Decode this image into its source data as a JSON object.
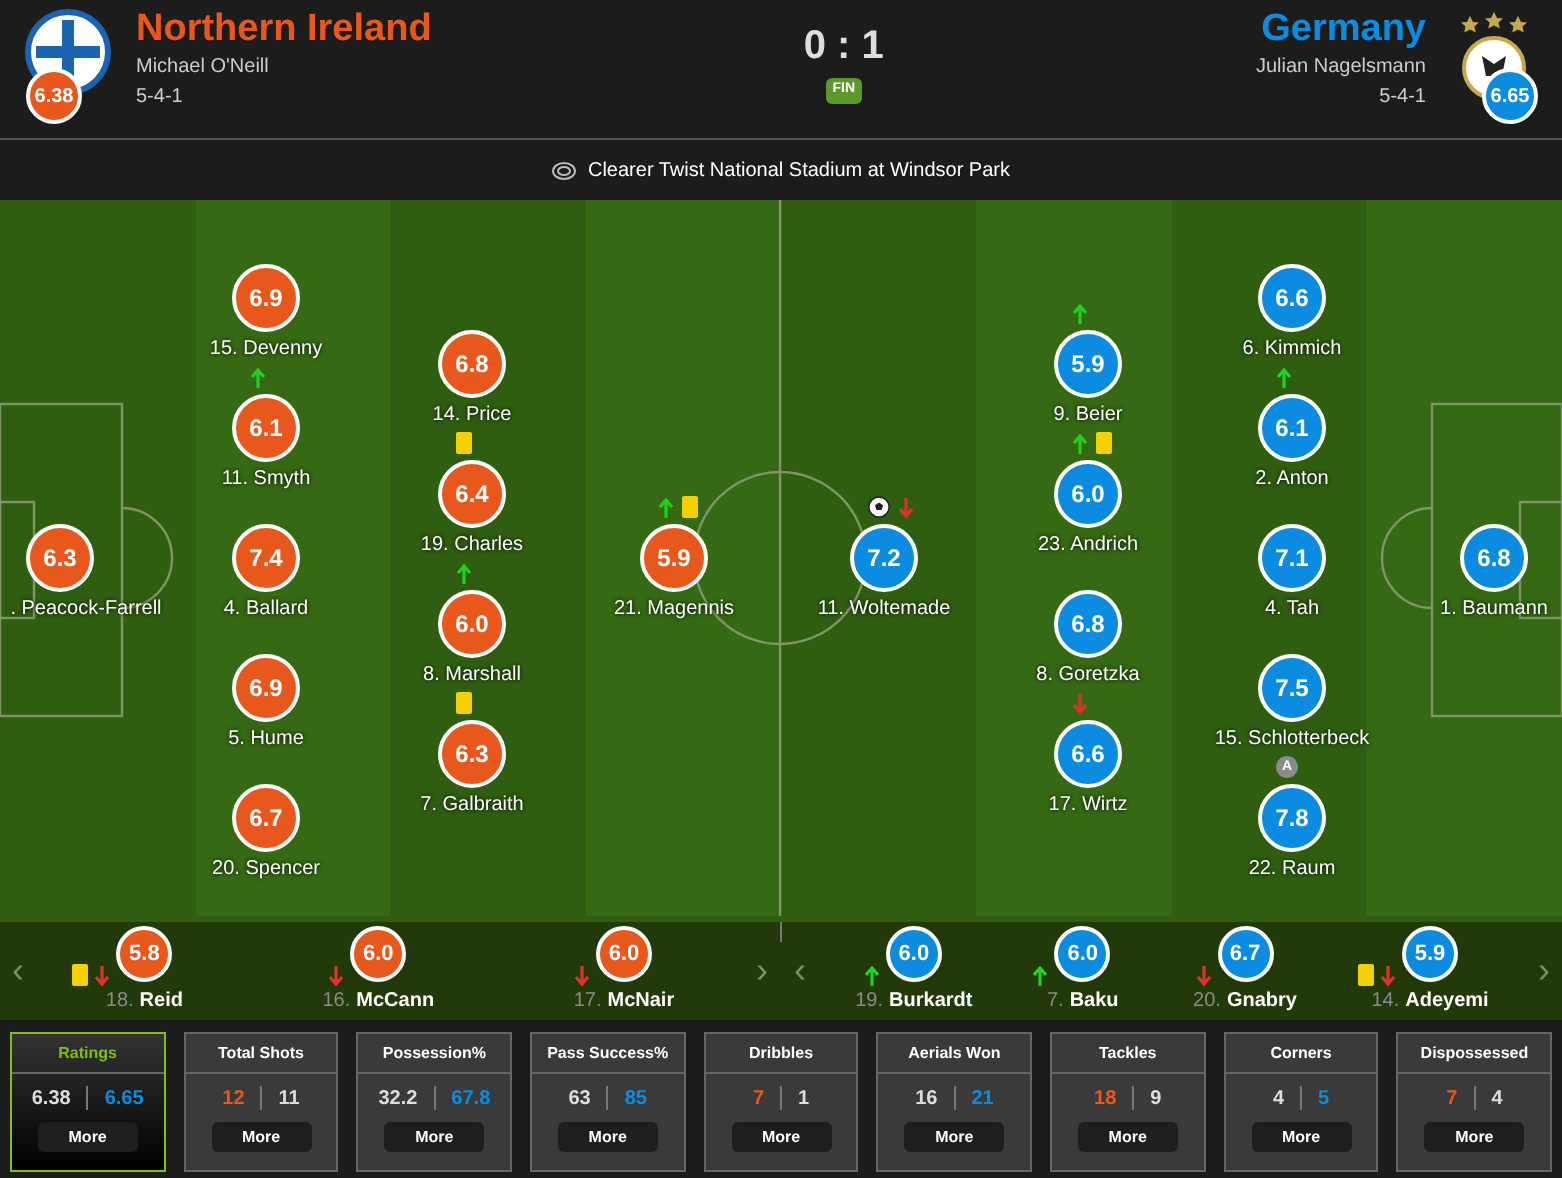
{
  "home": {
    "name": "Northern Ireland",
    "manager": "Michael O'Neill",
    "formation": "5-4-1",
    "rating": "6.38"
  },
  "away": {
    "name": "Germany",
    "manager": "Julian Nagelsmann",
    "formation": "5-4-1",
    "rating": "6.65"
  },
  "score": "0 : 1",
  "status": "FIN",
  "venue": "Clearer Twist National Stadium at Windsor Park",
  "home_lines": [
    [
      {
        "label": ". Peacock-Farrell",
        "rating": "6.3"
      }
    ],
    [
      {
        "label": "15. Devenny",
        "rating": "6.9"
      },
      {
        "label": "11. Smyth",
        "rating": "6.1",
        "sub_in": true
      },
      {
        "label": "4. Ballard",
        "rating": "7.4"
      },
      {
        "label": "5. Hume",
        "rating": "6.9"
      },
      {
        "label": "20. Spencer",
        "rating": "6.7"
      }
    ],
    [
      {
        "label": "14. Price",
        "rating": "6.8"
      },
      {
        "label": "19. Charles",
        "rating": "6.4",
        "yellow_card": true
      },
      {
        "label": "8. Marshall",
        "rating": "6.0",
        "sub_in": true
      },
      {
        "label": "7. Galbraith",
        "rating": "6.3",
        "yellow_card": true
      }
    ],
    [
      {
        "label": "21. Magennis",
        "rating": "5.9",
        "sub_in": true,
        "yellow_card": true
      }
    ]
  ],
  "away_lines": [
    [
      {
        "label": "11. Woltemade",
        "rating": "7.2",
        "goal": true,
        "sub_out": true
      }
    ],
    [
      {
        "label": "9. Beier",
        "rating": "5.9",
        "sub_in": true
      },
      {
        "label": "23. Andrich",
        "rating": "6.0",
        "sub_in": true,
        "yellow_card": true
      },
      {
        "label": "8. Goretzka",
        "rating": "6.8"
      },
      {
        "label": "17. Wirtz",
        "rating": "6.6",
        "sub_out": true
      }
    ],
    [
      {
        "label": "6. Kimmich",
        "rating": "6.6"
      },
      {
        "label": "2. Anton",
        "rating": "6.1",
        "sub_in": true
      },
      {
        "label": "4. Tah",
        "rating": "7.1"
      },
      {
        "label": "15. Schlotterbeck",
        "rating": "7.5"
      },
      {
        "label": "22. Raum",
        "rating": "7.8",
        "captain": "A"
      }
    ],
    [
      {
        "label": "1. Baumann",
        "rating": "6.8"
      }
    ]
  ],
  "bench_prev": "‹",
  "bench_next": "›",
  "home_bench": [
    {
      "number": "18.",
      "name": "Reid",
      "rating": "5.8",
      "yellow_card": true,
      "sub_out": true
    },
    {
      "number": "16.",
      "name": "McCann",
      "rating": "6.0",
      "sub_out": true
    },
    {
      "number": "17.",
      "name": "McNair",
      "rating": "6.0",
      "sub_out": true
    }
  ],
  "away_bench": [
    {
      "number": "19.",
      "name": "Burkardt",
      "rating": "6.0",
      "sub_in": true
    },
    {
      "number": "7.",
      "name": "Baku",
      "rating": "6.0",
      "sub_in": true
    },
    {
      "number": "20.",
      "name": "Gnabry",
      "rating": "6.7",
      "sub_out": true
    },
    {
      "number": "14.",
      "name": "Adeyemi",
      "rating": "5.9",
      "yellow_card": true,
      "sub_out": true
    }
  ],
  "stats": [
    {
      "title": "Ratings",
      "home": "6.38",
      "away": "6.65",
      "home_highlighted": false,
      "away_highlighted": true,
      "selected": true,
      "button": "More"
    },
    {
      "title": "Total Shots",
      "home": "12",
      "away": "11",
      "home_highlighted": true,
      "away_highlighted": false,
      "selected": false,
      "button": "More"
    },
    {
      "title": "Possession%",
      "home": "32.2",
      "away": "67.8",
      "home_highlighted": false,
      "away_highlighted": true,
      "selected": false,
      "button": "More"
    },
    {
      "title": "Pass Success%",
      "home": "63",
      "away": "85",
      "home_highlighted": false,
      "away_highlighted": true,
      "selected": false,
      "button": "More"
    },
    {
      "title": "Dribbles",
      "home": "7",
      "away": "1",
      "home_highlighted": true,
      "away_highlighted": false,
      "selected": false,
      "button": "More"
    },
    {
      "title": "Aerials Won",
      "home": "16",
      "away": "21",
      "home_highlighted": false,
      "away_highlighted": true,
      "selected": false,
      "button": "More"
    },
    {
      "title": "Tackles",
      "home": "18",
      "away": "9",
      "home_highlighted": true,
      "away_highlighted": false,
      "selected": false,
      "button": "More"
    },
    {
      "title": "Corners",
      "home": "4",
      "away": "5",
      "home_highlighted": false,
      "away_highlighted": true,
      "selected": false,
      "button": "More"
    },
    {
      "title": "Dispossessed",
      "home": "7",
      "away": "4",
      "home_highlighted": true,
      "away_highlighted": false,
      "selected": false,
      "button": "More"
    }
  ]
}
